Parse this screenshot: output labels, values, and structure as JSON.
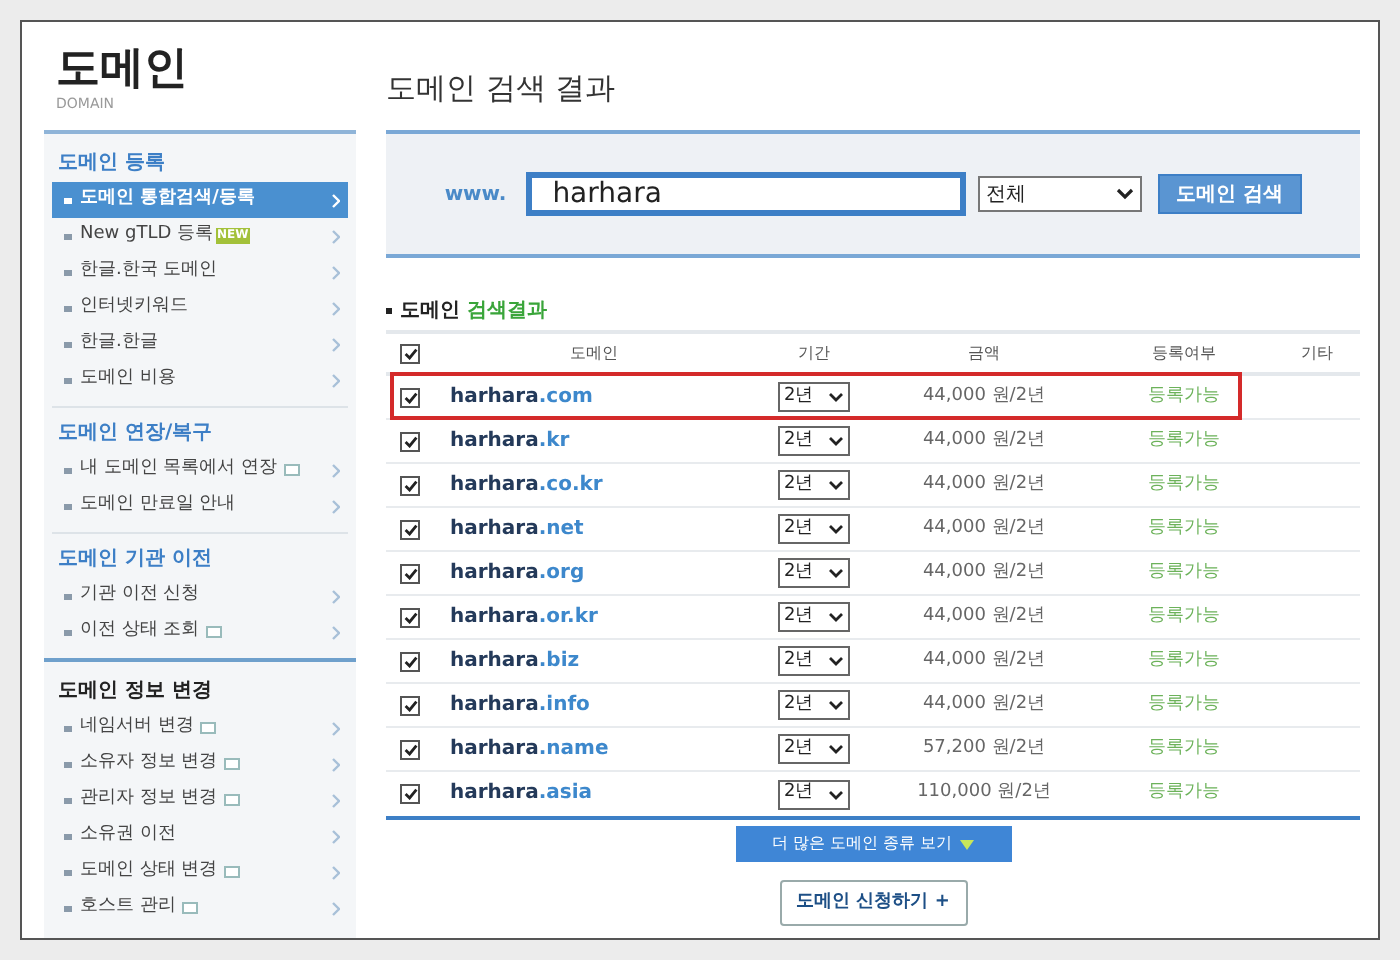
{
  "logo": {
    "title": "도메인",
    "subtitle": "DOMAIN"
  },
  "sidebar": {
    "groups": [
      {
        "title": "도메인 등록",
        "emphasized": false,
        "items": [
          {
            "label": "도메인 통합검색/등록",
            "selected": true,
            "popup": false
          },
          {
            "label": "New gTLD 등록",
            "selected": false,
            "popup": false,
            "badge": "NEW"
          },
          {
            "label": "한글.한국 도메인",
            "selected": false,
            "popup": false
          },
          {
            "label": "인터넷키워드",
            "selected": false,
            "popup": false
          },
          {
            "label": "한글.한글",
            "selected": false,
            "popup": false
          },
          {
            "label": "도메인 비용",
            "selected": false,
            "popup": false
          }
        ]
      },
      {
        "title": "도메인 연장/복구",
        "emphasized": false,
        "items": [
          {
            "label": "내 도메인 목록에서 연장",
            "selected": false,
            "popup": true
          },
          {
            "label": "도메인 만료일 안내",
            "selected": false,
            "popup": false
          }
        ]
      },
      {
        "title": "도메인 기관 이전",
        "emphasized": false,
        "items": [
          {
            "label": "기관 이전 신청",
            "selected": false,
            "popup": false
          },
          {
            "label": "이전 상태 조회",
            "selected": false,
            "popup": true
          }
        ]
      },
      {
        "title": "도메인 정보 변경",
        "emphasized": true,
        "items": [
          {
            "label": "네임서버 변경",
            "selected": false,
            "popup": true
          },
          {
            "label": "소유자 정보 변경",
            "selected": false,
            "popup": true
          },
          {
            "label": "관리자 정보 변경",
            "selected": false,
            "popup": true
          },
          {
            "label": "소유권 이전",
            "selected": false,
            "popup": false
          },
          {
            "label": "도메인 상태 변경",
            "selected": false,
            "popup": true
          },
          {
            "label": "호스트 관리",
            "selected": false,
            "popup": true
          }
        ]
      }
    ]
  },
  "page_title": "도메인 검색 결과",
  "search": {
    "prefix": "www.",
    "value": "harhara",
    "scope": "전체",
    "button": "도메인 검색"
  },
  "results": {
    "label": "도메인",
    "label_accent": "검색결과",
    "columns": [
      "도메인",
      "기간",
      "금액",
      "등록여부",
      "기타"
    ],
    "all_checked": true,
    "rows": [
      {
        "checked": true,
        "highlighted": true,
        "name": "harhara",
        "tld": ".com",
        "period": "2년",
        "price": "44,000 원/2년",
        "status": "등록가능"
      },
      {
        "checked": true,
        "highlighted": false,
        "name": "harhara",
        "tld": ".kr",
        "period": "2년",
        "price": "44,000 원/2년",
        "status": "등록가능"
      },
      {
        "checked": true,
        "highlighted": false,
        "name": "harhara",
        "tld": ".co.kr",
        "period": "2년",
        "price": "44,000 원/2년",
        "status": "등록가능"
      },
      {
        "checked": true,
        "highlighted": false,
        "name": "harhara",
        "tld": ".net",
        "period": "2년",
        "price": "44,000 원/2년",
        "status": "등록가능"
      },
      {
        "checked": true,
        "highlighted": false,
        "name": "harhara",
        "tld": ".org",
        "period": "2년",
        "price": "44,000 원/2년",
        "status": "등록가능"
      },
      {
        "checked": true,
        "highlighted": false,
        "name": "harhara",
        "tld": ".or.kr",
        "period": "2년",
        "price": "44,000 원/2년",
        "status": "등록가능"
      },
      {
        "checked": true,
        "highlighted": false,
        "name": "harhara",
        "tld": ".biz",
        "period": "2년",
        "price": "44,000 원/2년",
        "status": "등록가능"
      },
      {
        "checked": true,
        "highlighted": false,
        "name": "harhara",
        "tld": ".info",
        "period": "2년",
        "price": "44,000 원/2년",
        "status": "등록가능"
      },
      {
        "checked": true,
        "highlighted": false,
        "name": "harhara",
        "tld": ".name",
        "period": "2년",
        "price": "57,200 원/2년",
        "status": "등록가능"
      },
      {
        "checked": true,
        "highlighted": false,
        "name": "harhara",
        "tld": ".asia",
        "period": "2년",
        "price": "110,000 원/2년",
        "status": "등록가능"
      }
    ],
    "more_button": "더 많은 도메인 종류 보기",
    "apply_button": "도메인 신청하기 +"
  }
}
